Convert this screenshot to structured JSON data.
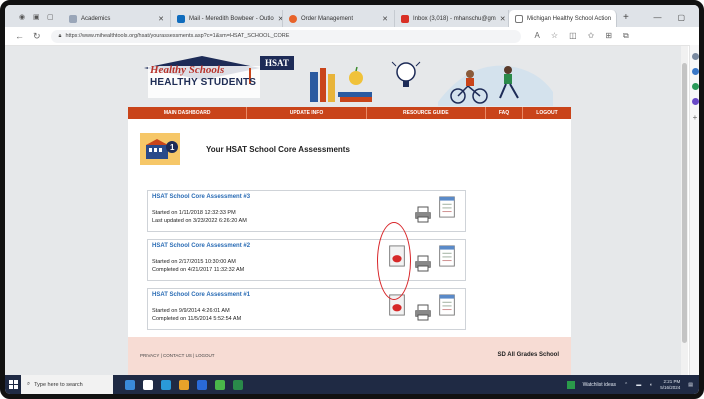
{
  "browser": {
    "tabs": [
      {
        "label": "Academics"
      },
      {
        "label": "Mail - Meredith Bowbeer - Outlo"
      },
      {
        "label": "Order Management"
      },
      {
        "label": "Inbox (3,018) - mhanschu@gm"
      },
      {
        "label": "Michigan Healthy School Action",
        "active": true
      }
    ],
    "url": "https://www.mihealthtools.org/hsat/yourassessments.asp?c=1&sm=HSAT_SCHOOL_CORE"
  },
  "site": {
    "logo_title": "Healthy Schools",
    "logo_subtitle": "HEALTHY STUDENTS",
    "logo_badge": "HSAT",
    "nav": [
      "MAIN DASHBOARD",
      "UPDATE INFO",
      "RESOURCE GUIDE",
      "FAQ",
      "LOGOUT"
    ],
    "header_title": "Your HSAT School Core Assessments",
    "assessments": [
      {
        "title": "HSAT School Core Assessment #3",
        "line1": "Started on 1/11/2018 12:32:33 PM",
        "line2": "Last updated on 3/23/2022 6:26:20 AM",
        "has_report": false
      },
      {
        "title": "HSAT School Core Assessment #2",
        "line1": "Started on 2/17/2015 10:30:00 AM",
        "line2": "Completed on 4/21/2017 11:32:32 AM",
        "has_report": true
      },
      {
        "title": "HSAT School Core Assessment #1",
        "line1": "Started on 9/9/2014 4:26:01 AM",
        "line2": "Completed on 11/5/2014 5:52:54 AM",
        "has_report": true
      }
    ],
    "footer_links": "PRIVACY  |  CONTACT US  |  LOGOUT",
    "school_name": "SD All Grades School"
  },
  "taskbar": {
    "search_placeholder": "Type here to search",
    "weather": "Watchlist ideas",
    "time": "2:21 PM",
    "date": "5/16/2024"
  },
  "colors": {
    "nav_orange": "#c9441a",
    "footer_pink": "#f7dcd4",
    "link_blue": "#2a6cb5",
    "annotation_red": "#d8262a",
    "taskbar": "#1f2a44"
  }
}
